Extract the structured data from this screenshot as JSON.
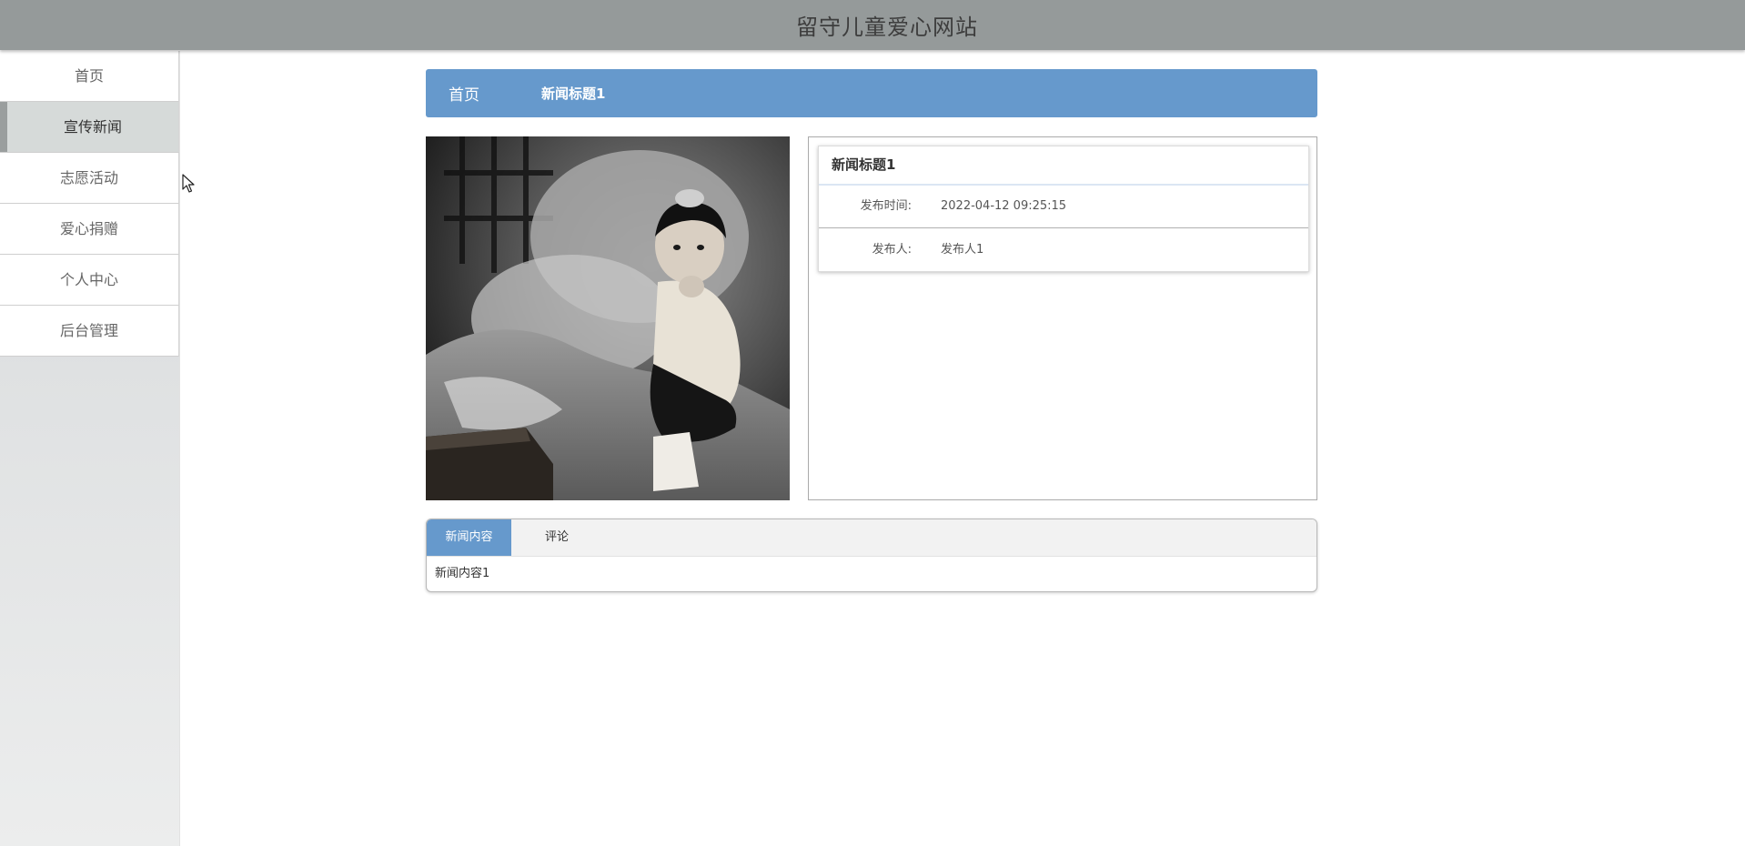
{
  "header": {
    "title": "留守儿童爱心网站"
  },
  "sidebar": {
    "items": [
      {
        "label": "首页"
      },
      {
        "label": "宣传新闻"
      },
      {
        "label": "志愿活动"
      },
      {
        "label": "爱心捐赠"
      },
      {
        "label": "个人中心"
      },
      {
        "label": "后台管理"
      }
    ],
    "active_index": 1
  },
  "breadcrumb": {
    "home": "首页",
    "current": "新闻标题1"
  },
  "news": {
    "photo_icon": "news-photo",
    "title": "新闻标题1",
    "publish_time_label": "发布时间:",
    "publish_time": "2022-04-12 09:25:15",
    "publisher_label": "发布人:",
    "publisher": "发布人1"
  },
  "tabs": {
    "items": [
      {
        "label": "新闻内容"
      },
      {
        "label": "评论"
      }
    ],
    "active_index": 0,
    "content": "新闻内容1"
  },
  "colors": {
    "header_bg": "#959a9a",
    "accent": "#6699cc",
    "active_nav_bg": "#d6dad9"
  }
}
